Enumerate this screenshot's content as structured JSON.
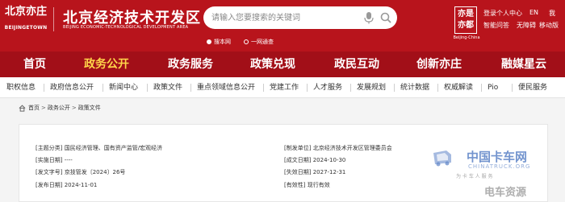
{
  "header": {
    "logo_glyph": "北京亦庄",
    "logo_en": "BEIJINGETOWN",
    "title": "北京经济技术开发区",
    "subtitle": "BEIJING ECONOMIC-TECHNOLOGICAL DEVELOPMENT AREA",
    "search": {
      "placeholder": "请输入您要搜索的关键词",
      "scopes": [
        {
          "label": "搜本网",
          "selected": true
        },
        {
          "label": "一网通查",
          "selected": false
        }
      ]
    },
    "badge": {
      "text": "亦是亦都",
      "sub": "Beijing-China"
    },
    "links": {
      "personal_center": "登录个人中心",
      "english": "EN",
      "accessibility": "我",
      "elderly": "智能问答",
      "barrier_free": "无障碍",
      "mobile": "移动版"
    },
    "colors": {
      "brand_red": "#b8141c",
      "nav_red": "#a20f18",
      "active_nav": "#ffd54a"
    }
  },
  "nav": {
    "items": [
      {
        "label": "首页",
        "active": false
      },
      {
        "label": "政务公开",
        "active": true
      },
      {
        "label": "政务服务",
        "active": false
      },
      {
        "label": "政策兑现",
        "active": false
      },
      {
        "label": "政民互动",
        "active": false
      },
      {
        "label": "创新亦庄",
        "active": false
      },
      {
        "label": "融媒星云",
        "active": false
      }
    ]
  },
  "subnav": {
    "items": [
      "职权信息",
      "政府信息公开",
      "新闻中心",
      "政策文件",
      "重点领域信息公开",
      "党建工作",
      "人才服务",
      "发展规划",
      "统计数据",
      "权威解读",
      "Pio",
      "便民服务"
    ]
  },
  "breadcrumb": [
    "首页",
    "政务公开",
    "政策文件"
  ],
  "document_info": {
    "topic_label": "[主题分类]",
    "topic": "国民经济管理、国有资产监管/宏观经济",
    "issuer_label": "[制发单位]",
    "issuer": "北京经济技术开发区管理委员会",
    "implement_label": "[实施日期]",
    "implement": "----",
    "created_label": "[成文日期]",
    "created": "2024-10-30",
    "doc_no_label": "[发文字号]",
    "doc_no": "京技管发〔2024〕26号",
    "expire_label": "[失效日期]",
    "expire": "2027-12-31",
    "published_label": "[发布日期]",
    "published": "2024-11-01",
    "validity_label": "[有效性]",
    "validity": "现行有效"
  },
  "watermark": {
    "cn": "中国卡车网",
    "en": "CHINATRUCK.ORG",
    "slogan": "为 卡 车 人 服 务",
    "brand": "电车资源"
  }
}
